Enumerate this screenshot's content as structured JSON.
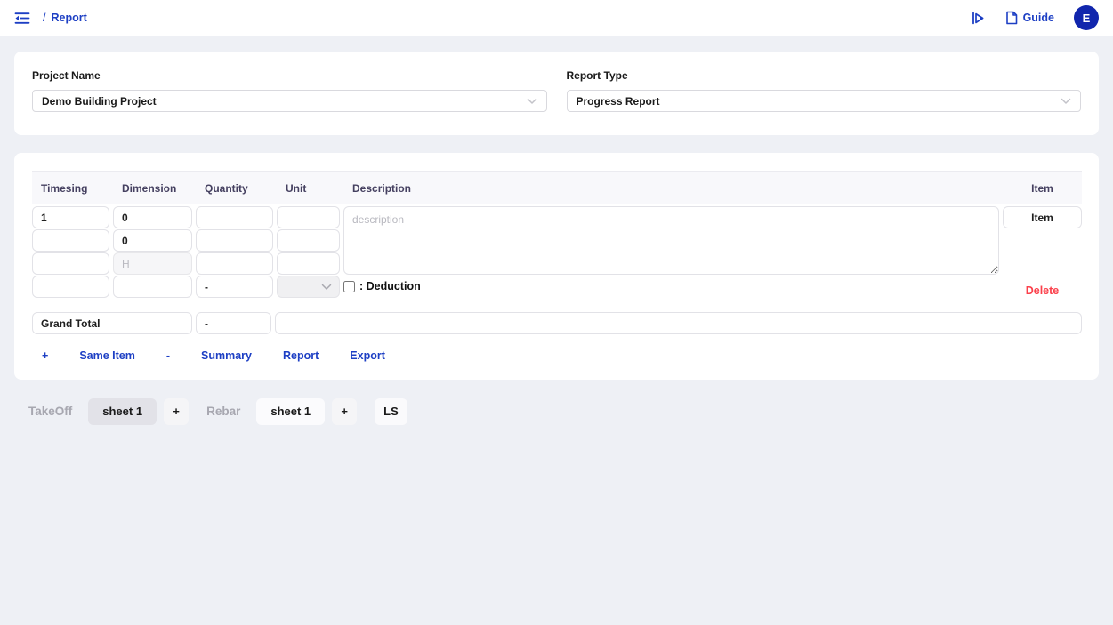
{
  "topbar": {
    "breadcrumb_slash": "/",
    "breadcrumb": "Report",
    "guide_label": "Guide",
    "avatar_initial": "E"
  },
  "filters": {
    "project_name": {
      "label": "Project Name",
      "value": "Demo Building Project"
    },
    "report_type": {
      "label": "Report Type",
      "value": "Progress Report"
    }
  },
  "table": {
    "headers": {
      "timesing": "Timesing",
      "dimension": "Dimension",
      "quantity": "Quantity",
      "unit": "Unit",
      "description": "Description",
      "item": "Item"
    },
    "rows": [
      {
        "timesing": "1",
        "dimension": "0",
        "quantity": "",
        "unit": ""
      },
      {
        "timesing": "",
        "dimension": "0",
        "quantity": "",
        "unit": ""
      },
      {
        "timesing": "",
        "dimension": "",
        "dimension_placeholder": "H",
        "quantity": "",
        "unit": ""
      }
    ],
    "description_placeholder": "description",
    "item_value": "Item",
    "deduction_row": {
      "timesing": "",
      "dimension": "",
      "quantity": "-",
      "label": ": Deduction"
    },
    "delete_label": "Delete",
    "grand_total": {
      "label_value": "Grand Total",
      "quantity": "-",
      "description": ""
    },
    "actions": {
      "add": "+",
      "same_item": "Same Item",
      "minus": "-",
      "summary": "Summary",
      "report": "Report",
      "export": "Export"
    }
  },
  "sheetbar": {
    "takeoff_label": "TakeOff",
    "takeoff_sheet": "sheet 1",
    "takeoff_add": "+",
    "rebar_label": "Rebar",
    "rebar_sheet": "sheet 1",
    "rebar_add": "+",
    "ls_label": "LS"
  },
  "colors": {
    "accent_blue": "#1d3fc4",
    "avatar_blue": "#1126ad",
    "danger_red": "#fb404b",
    "header_text": "#454060",
    "page_background": "#eef0f5"
  }
}
